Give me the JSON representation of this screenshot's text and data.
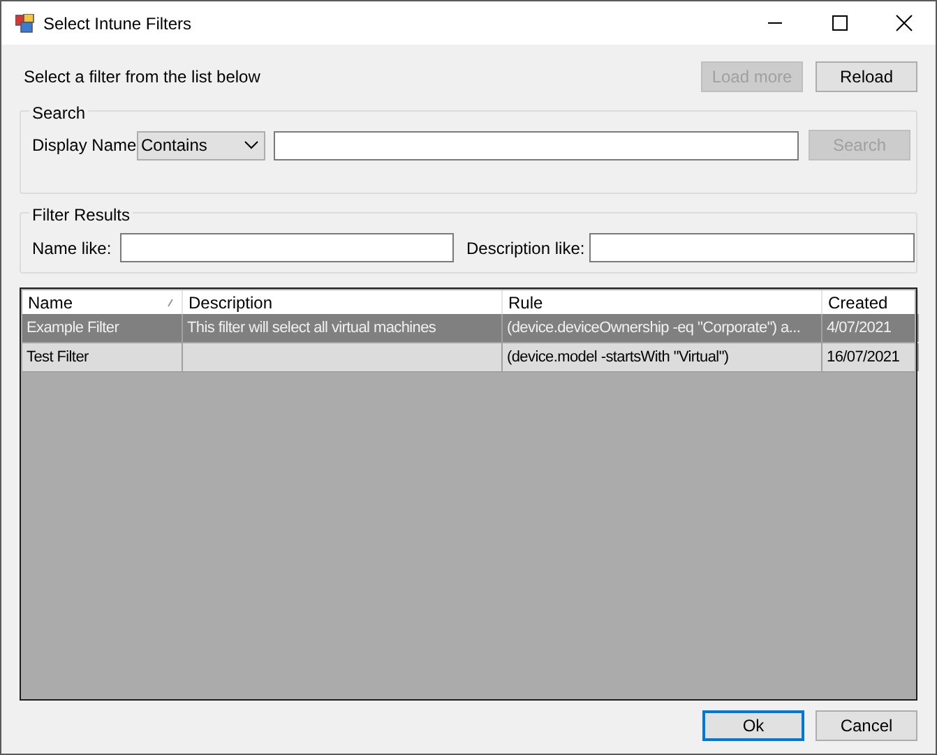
{
  "window": {
    "title": "Select Intune Filters"
  },
  "intro": "Select a filter from the list below",
  "top_buttons": [
    {
      "label": "Load more",
      "disabled": true
    },
    {
      "label": "Reload",
      "disabled": false
    }
  ],
  "search": {
    "title": "Search",
    "field_label": "Display Name",
    "operator": "Contains",
    "button": {
      "label": "Search",
      "disabled": true
    }
  },
  "filter_results": {
    "title": "Filter Results",
    "name_label": "Name like:",
    "description_label": "Description like:"
  },
  "table": {
    "columns": [
      "Name",
      "Description",
      "Rule",
      "Created"
    ],
    "rows": [
      {
        "cells": [
          "Example Filter",
          "This filter will select all virtual machines",
          "(device.deviceOwnership -eq \"Corporate\") a...",
          "4/07/2021"
        ],
        "selected": true
      },
      {
        "cells": [
          "Test Filter",
          "",
          "(device.model -startsWith \"Virtual\")",
          "16/07/2021"
        ],
        "selected": false
      }
    ]
  },
  "buttons": [
    {
      "label": "Ok",
      "default": true
    },
    {
      "label": "Cancel",
      "default": false
    }
  ]
}
